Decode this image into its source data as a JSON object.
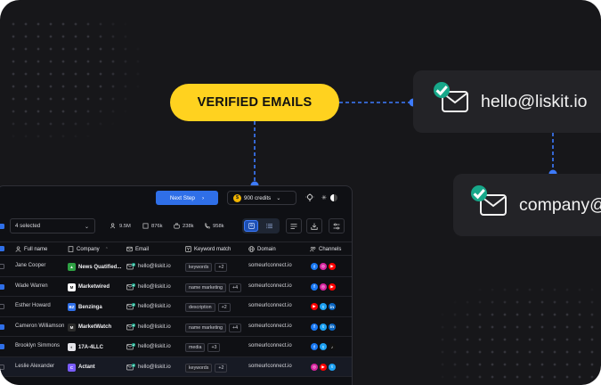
{
  "callout": {
    "label": "VERIFIED EMAILS"
  },
  "emails": [
    {
      "address": "hello@liskit.io"
    },
    {
      "address": "company@"
    }
  ],
  "colors": {
    "accent_yellow": "#ffd21f",
    "verified_green": "#17a88a",
    "primary_blue": "#2f6fe8",
    "panel_bg": "#0f1014"
  },
  "app": {
    "next_step_label": "Next Step",
    "credits_label": "900 credits",
    "selection_label": "4 selected",
    "stats": [
      {
        "icon": "users-icon",
        "value": "9.5M"
      },
      {
        "icon": "building-icon",
        "value": "876k"
      },
      {
        "icon": "briefcase-icon",
        "value": "238k"
      },
      {
        "icon": "phone-icon",
        "value": "958k"
      }
    ],
    "columns": {
      "full_name": "Full name",
      "company": "Company",
      "email": "Email",
      "keyword_match": "Keyword match",
      "domain": "Domain",
      "channels": "Channels"
    },
    "rows": [
      {
        "selected": false,
        "name": "Jane Cooper",
        "company": "News Quatified...",
        "logo_color": "#2ea043",
        "logo_glyph": "▲",
        "email": "hello@liskit.io",
        "keyword": "keywords",
        "more": "+2",
        "domain": "someurlconnect.io",
        "channels": [
          "facebook",
          "instagram",
          "youtube"
        ]
      },
      {
        "selected": true,
        "name": "Wade Warren",
        "company": "Marketwired",
        "logo_color": "#ffffff",
        "logo_glyph": "M",
        "email": "hello@liskit.io",
        "keyword": "name marketing",
        "more": "+4",
        "domain": "someurlconnect.io",
        "channels": [
          "facebook",
          "instagram",
          "youtube"
        ]
      },
      {
        "selected": false,
        "name": "Esther Howard",
        "company": "Benzinga",
        "logo_color": "#2f6fe8",
        "logo_glyph": "BZ",
        "email": "hello@liskit.io",
        "keyword": "description",
        "more": "+2",
        "domain": "someurlconnect.io",
        "channels": [
          "youtube",
          "twitter",
          "linkedin"
        ]
      },
      {
        "selected": true,
        "name": "Cameron Williamson",
        "company": "MarketWatch",
        "logo_color": "#2b2b2b",
        "logo_glyph": "M",
        "email": "hello@liskit.io",
        "keyword": "name marketing",
        "more": "+4",
        "domain": "someurlconnect.io",
        "channels": [
          "facebook",
          "twitter",
          "linkedin"
        ]
      },
      {
        "selected": true,
        "name": "Brooklyn Simmons",
        "company": "17A-4LLC",
        "logo_color": "#e5e5ea",
        "logo_glyph": "◐",
        "email": "hello@liskit.io",
        "keyword": "media",
        "more": "+3",
        "domain": "someurlconnect.io",
        "channels": [
          "facebook",
          "twitter",
          "tiktok"
        ]
      },
      {
        "selected": false,
        "name": "Leslie Alexander",
        "company": "Actant",
        "logo_color": "#7a5cff",
        "logo_glyph": "C",
        "email": "hello@liskit.io",
        "keyword": "keywords",
        "more": "+2",
        "domain": "someurlconnect.io",
        "channels": [
          "instagram",
          "youtube",
          "twitter"
        ]
      }
    ]
  }
}
